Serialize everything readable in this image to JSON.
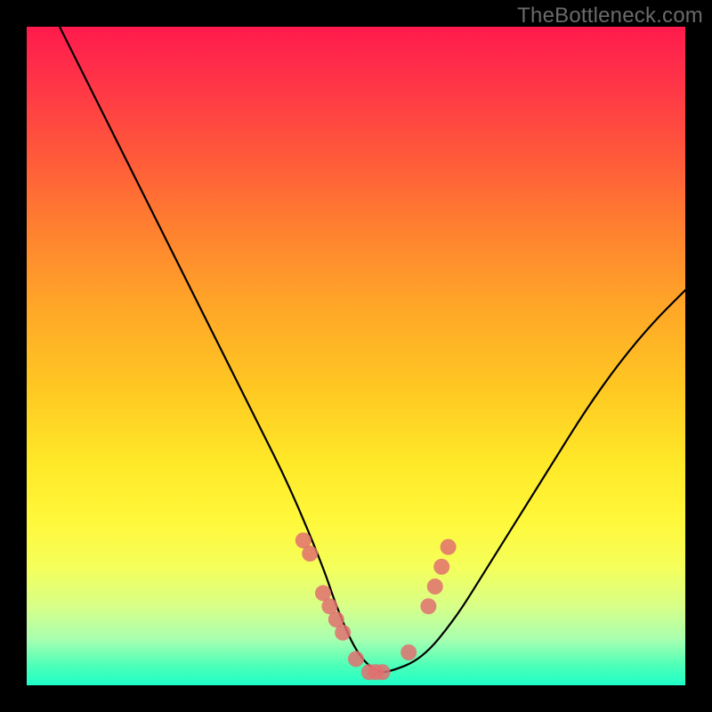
{
  "watermark": "TheBottleneck.com",
  "chart_data": {
    "type": "line",
    "title": "",
    "xlabel": "",
    "ylabel": "",
    "xlim": [
      0,
      100
    ],
    "ylim": [
      0,
      100
    ],
    "grid": false,
    "legend": false,
    "series": [
      {
        "name": "curve",
        "x": [
          5,
          10,
          15,
          20,
          25,
          30,
          35,
          40,
          45,
          47,
          50,
          53,
          55,
          60,
          65,
          70,
          75,
          80,
          85,
          90,
          95,
          100
        ],
        "y": [
          100,
          90,
          80,
          70,
          60,
          50,
          40,
          30,
          18,
          12,
          5,
          2,
          2,
          4,
          10,
          18,
          26,
          34,
          42,
          49,
          55,
          60
        ]
      }
    ],
    "highlight_points": {
      "name": "dots",
      "x": [
        42,
        43,
        45,
        46,
        47,
        48,
        50,
        52,
        53,
        54,
        58,
        61,
        62,
        63,
        64
      ],
      "y": [
        22,
        20,
        14,
        12,
        10,
        8,
        4,
        2,
        2,
        2,
        5,
        12,
        15,
        18,
        21
      ]
    }
  }
}
